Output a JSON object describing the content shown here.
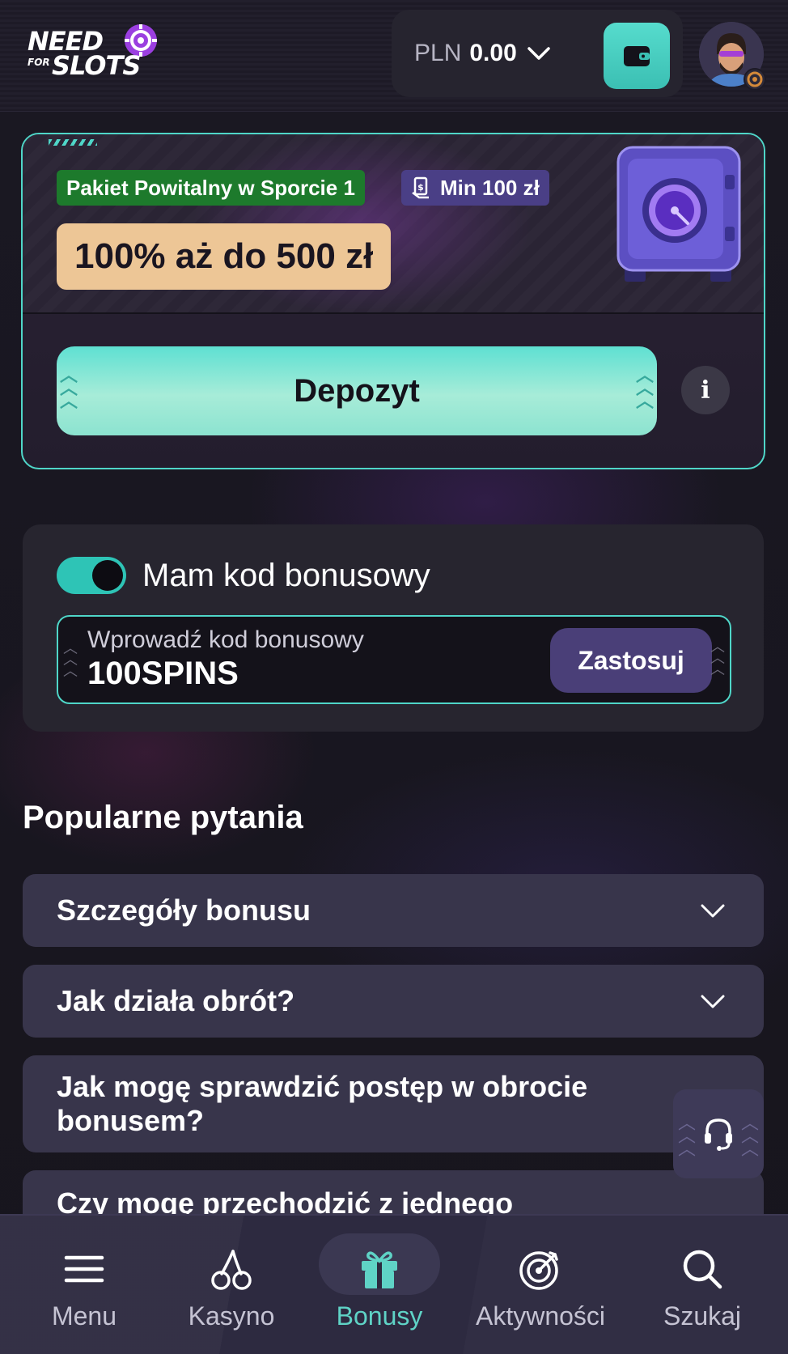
{
  "header": {
    "logo_text_top": "NEED",
    "logo_text_mid": "FOR",
    "logo_text_bottom": "SLOTS",
    "currency": "PLN",
    "balance": "0.00"
  },
  "bonus_card": {
    "tag_main": "Pakiet Powitalny w Sporcie 1",
    "tag_min": "Min 100 zł",
    "offer": "100% aż do 500 zł",
    "deposit_label": "Depozyt",
    "info_label": "i"
  },
  "bonus_code": {
    "toggle_on": true,
    "title": "Mam kod bonusowy",
    "input_label": "Wprowadź kod bonusowy",
    "input_value": "100SPINS",
    "apply_label": "Zastosuj"
  },
  "faq": {
    "title": "Popularne pytania",
    "items": [
      {
        "q": "Szczegóły bonusu"
      },
      {
        "q": "Jak działa obrót?"
      },
      {
        "q": "Jak mogę sprawdzić postęp w obrocie bonusem?"
      },
      {
        "q": "Czy mogę przechodzić z jednego"
      }
    ]
  },
  "nav": {
    "items": [
      {
        "label": "Menu",
        "icon": "menu-icon"
      },
      {
        "label": "Kasyno",
        "icon": "cherries-icon"
      },
      {
        "label": "Bonusy",
        "icon": "gift-icon"
      },
      {
        "label": "Aktywności",
        "icon": "target-icon"
      },
      {
        "label": "Szukaj",
        "icon": "search-icon"
      }
    ],
    "active": "Bonusy"
  },
  "colors": {
    "accent_teal": "#4fd6c8",
    "background": "#16141d",
    "offer_bg": "#edc696",
    "tag_green": "#1d7a2c",
    "tag_purple": "#4a3f86"
  }
}
